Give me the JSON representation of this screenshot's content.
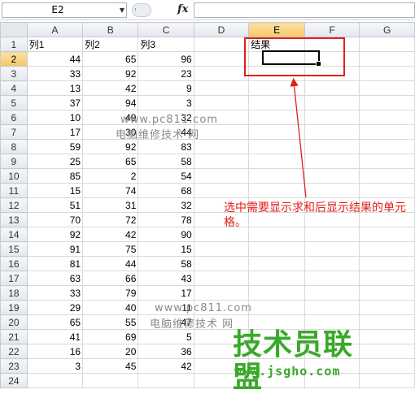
{
  "formula_bar": {
    "name_box": "E2",
    "fx_label": "fx",
    "formula": ""
  },
  "columns": [
    "A",
    "B",
    "C",
    "D",
    "E",
    "F",
    "G"
  ],
  "selected_column": "E",
  "selected_row": 2,
  "rows": [
    {
      "n": "1",
      "A": "列1",
      "B": "列2",
      "C": "列3",
      "E": "结果"
    },
    {
      "n": "2",
      "A": "44",
      "B": "65",
      "C": "96"
    },
    {
      "n": "3",
      "A": "33",
      "B": "92",
      "C": "23"
    },
    {
      "n": "4",
      "A": "13",
      "B": "42",
      "C": "9"
    },
    {
      "n": "5",
      "A": "37",
      "B": "94",
      "C": "3"
    },
    {
      "n": "6",
      "A": "10",
      "B": "49",
      "C": "32"
    },
    {
      "n": "7",
      "A": "17",
      "B": "30",
      "C": "44"
    },
    {
      "n": "8",
      "A": "59",
      "B": "92",
      "C": "83"
    },
    {
      "n": "9",
      "A": "25",
      "B": "65",
      "C": "58"
    },
    {
      "n": "10",
      "A": "85",
      "B": "2",
      "C": "54"
    },
    {
      "n": "11",
      "A": "15",
      "B": "74",
      "C": "68"
    },
    {
      "n": "12",
      "A": "51",
      "B": "31",
      "C": "32"
    },
    {
      "n": "13",
      "A": "70",
      "B": "72",
      "C": "78"
    },
    {
      "n": "14",
      "A": "92",
      "B": "42",
      "C": "90"
    },
    {
      "n": "15",
      "A": "91",
      "B": "75",
      "C": "15"
    },
    {
      "n": "16",
      "A": "81",
      "B": "44",
      "C": "58"
    },
    {
      "n": "17",
      "A": "63",
      "B": "66",
      "C": "43"
    },
    {
      "n": "18",
      "A": "33",
      "B": "79",
      "C": "17"
    },
    {
      "n": "19",
      "A": "29",
      "B": "40",
      "C": "11"
    },
    {
      "n": "20",
      "A": "65",
      "B": "55",
      "C": "47"
    },
    {
      "n": "21",
      "A": "41",
      "B": "69",
      "C": "5"
    },
    {
      "n": "22",
      "A": "16",
      "B": "20",
      "C": "36"
    },
    {
      "n": "23",
      "A": "3",
      "B": "45",
      "C": "42"
    },
    {
      "n": "24"
    }
  ],
  "annotation": "选中需要显示求和后显示结果的单元格。",
  "watermarks": {
    "url1": "www.pc811.com",
    "site1": "电脑维修技术 网",
    "url2": "www.pc811.com",
    "site2": "电脑维修技术 网"
  },
  "logo": {
    "name": "技术员联盟",
    "url": "www.jsgho.com"
  },
  "colors": {
    "annotation_red": "#e0201b",
    "logo_green": "#3aa82a",
    "selected_header": "#f6c766"
  }
}
